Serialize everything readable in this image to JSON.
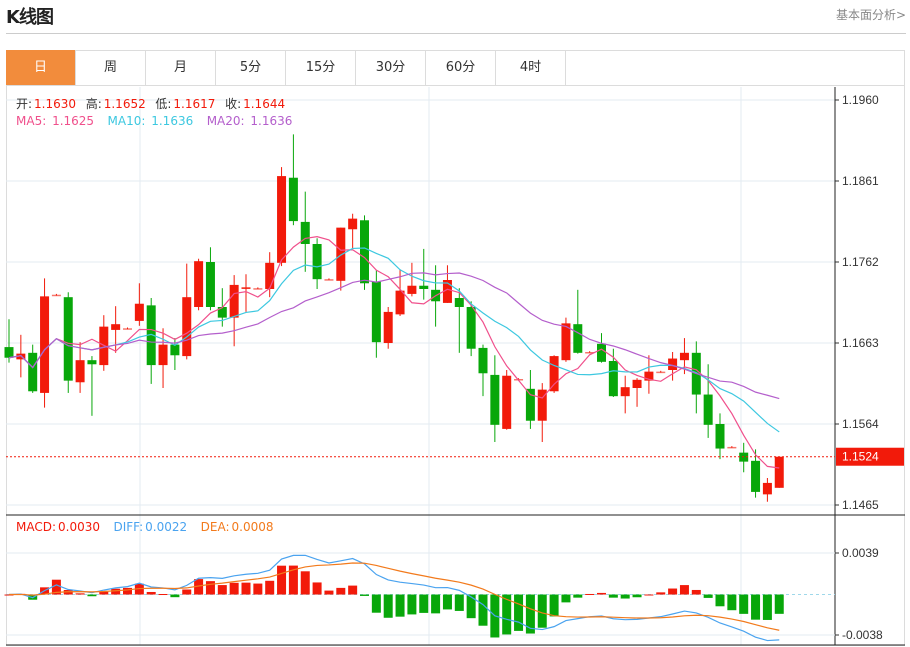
{
  "header": {
    "title": "K线图",
    "more_link": "基本面分析>"
  },
  "tabs": [
    {
      "label": "日",
      "active": true
    },
    {
      "label": "周"
    },
    {
      "label": "月"
    },
    {
      "label": "5分"
    },
    {
      "label": "15分"
    },
    {
      "label": "30分"
    },
    {
      "label": "60分"
    },
    {
      "label": "4时"
    }
  ],
  "ohlc_info": {
    "open_label": "开:",
    "open": "1.1630",
    "high_label": "高:",
    "high": "1.1652",
    "low_label": "低:",
    "low": "1.1617",
    "close_label": "收:",
    "close": "1.1644"
  },
  "ma_info": {
    "ma5_label": "MA5:",
    "ma5": "1.1625",
    "ma10_label": "MA10:",
    "ma10": "1.1636",
    "ma20_label": "MA20:",
    "ma20": "1.1636"
  },
  "macd_info": {
    "macd_label": "MACD:",
    "macd": "0.0030",
    "diff_label": "DIFF:",
    "diff": "0.0022",
    "dea_label": "DEA:",
    "dea": "0.0008"
  },
  "colors": {
    "up": "#f21a0a",
    "down": "#08a70a",
    "ma5": "#f0508c",
    "ma10": "#3dc8e0",
    "ma20": "#b45fcc",
    "diff": "#4aa3ef",
    "dea": "#f27a1c",
    "active_tab": "#f28c3c",
    "last_price": "#f21a0a"
  },
  "chart_data": [
    {
      "type": "candlestick",
      "y_ticks": [
        "1.1960",
        "1.1861",
        "1.1762",
        "1.1663",
        "1.1564",
        "1.1465"
      ],
      "ylim": [
        1.1465,
        1.196
      ],
      "last_price": "1.1524",
      "grid": true,
      "ohlc": [
        [
          1.1658,
          1.1692,
          1.1639,
          1.1645
        ],
        [
          1.1643,
          1.1673,
          1.1621,
          1.165
        ],
        [
          1.1651,
          1.1661,
          1.1602,
          1.1604
        ],
        [
          1.1602,
          1.1742,
          1.1584,
          1.172
        ],
        [
          1.1722,
          1.1723,
          1.1721,
          1.1722
        ],
        [
          1.1719,
          1.1725,
          1.1602,
          1.1617
        ],
        [
          1.1615,
          1.1664,
          1.1602,
          1.1642
        ],
        [
          1.1642,
          1.1647,
          1.1574,
          1.1637
        ],
        [
          1.1636,
          1.1697,
          1.1629,
          1.1683
        ],
        [
          1.1679,
          1.1708,
          1.1651,
          1.1686
        ],
        [
          1.1681,
          1.1682,
          1.168,
          1.1681
        ],
        [
          1.169,
          1.1736,
          1.1684,
          1.1711
        ],
        [
          1.1709,
          1.1718,
          1.1613,
          1.1636
        ],
        [
          1.1636,
          1.1681,
          1.1608,
          1.1661
        ],
        [
          1.1661,
          1.1669,
          1.163,
          1.1648
        ],
        [
          1.1647,
          1.176,
          1.1643,
          1.1719
        ],
        [
          1.1707,
          1.1766,
          1.1703,
          1.1763
        ],
        [
          1.1762,
          1.178,
          1.1703,
          1.1707
        ],
        [
          1.1707,
          1.173,
          1.1683,
          1.1694
        ],
        [
          1.1694,
          1.1746,
          1.1659,
          1.1734
        ],
        [
          1.173,
          1.1747,
          1.1701,
          1.1731
        ],
        [
          1.173,
          1.1731,
          1.1729,
          1.173
        ],
        [
          1.1729,
          1.1774,
          1.1719,
          1.1761
        ],
        [
          1.1761,
          1.1878,
          1.1757,
          1.1867
        ],
        [
          1.1865,
          1.1918,
          1.1807,
          1.1812
        ],
        [
          1.1811,
          1.1848,
          1.175,
          1.1784
        ],
        [
          1.1784,
          1.1791,
          1.1729,
          1.1741
        ],
        [
          1.1741,
          1.1742,
          1.174,
          1.1741
        ],
        [
          1.1739,
          1.1804,
          1.1727,
          1.1804
        ],
        [
          1.1802,
          1.1821,
          1.1779,
          1.1815
        ],
        [
          1.1813,
          1.1819,
          1.1728,
          1.1736
        ],
        [
          1.1738,
          1.1752,
          1.1645,
          1.1664
        ],
        [
          1.1663,
          1.1707,
          1.1656,
          1.1701
        ],
        [
          1.1698,
          1.1753,
          1.1696,
          1.1727
        ],
        [
          1.1723,
          1.1761,
          1.172,
          1.1733
        ],
        [
          1.1733,
          1.1778,
          1.1716,
          1.1729
        ],
        [
          1.1728,
          1.1758,
          1.1683,
          1.1714
        ],
        [
          1.1712,
          1.1758,
          1.1712,
          1.174
        ],
        [
          1.1718,
          1.173,
          1.1651,
          1.1707
        ],
        [
          1.1707,
          1.1714,
          1.1647,
          1.1656
        ],
        [
          1.1657,
          1.1661,
          1.1598,
          1.1626
        ],
        [
          1.1624,
          1.1648,
          1.1542,
          1.1563
        ],
        [
          1.1558,
          1.163,
          1.1557,
          1.1623
        ],
        [
          1.1619,
          1.162,
          1.1618,
          1.1619
        ],
        [
          1.1607,
          1.163,
          1.1558,
          1.1568
        ],
        [
          1.1568,
          1.1614,
          1.1542,
          1.1606
        ],
        [
          1.1604,
          1.1648,
          1.1602,
          1.1647
        ],
        [
          1.1642,
          1.1694,
          1.164,
          1.1687
        ],
        [
          1.1686,
          1.1728,
          1.165,
          1.1651
        ],
        [
          1.1652,
          1.1653,
          1.1651,
          1.1652
        ],
        [
          1.1662,
          1.1675,
          1.1639,
          1.164
        ],
        [
          1.1641,
          1.1656,
          1.1597,
          1.1598
        ],
        [
          1.1598,
          1.1623,
          1.1577,
          1.1609
        ],
        [
          1.1608,
          1.162,
          1.1585,
          1.1618
        ],
        [
          1.1617,
          1.1648,
          1.1601,
          1.1628
        ],
        [
          1.1628,
          1.1629,
          1.1627,
          1.1628
        ],
        [
          1.163,
          1.1652,
          1.1617,
          1.1644
        ],
        [
          1.1642,
          1.1669,
          1.1625,
          1.1651
        ],
        [
          1.1651,
          1.1665,
          1.1577,
          1.16
        ],
        [
          1.16,
          1.1637,
          1.1547,
          1.1563
        ],
        [
          1.1564,
          1.1577,
          1.1521,
          1.1534
        ],
        [
          1.1536,
          1.1537,
          1.1535,
          1.1536
        ],
        [
          1.1529,
          1.1541,
          1.1505,
          1.1518
        ],
        [
          1.1519,
          1.1533,
          1.1474,
          1.1481
        ],
        [
          1.1478,
          1.1498,
          1.1469,
          1.1492
        ],
        [
          1.1486,
          1.1524,
          1.1486,
          1.1524
        ]
      ],
      "moving_averages": [
        "MA5",
        "MA10",
        "MA20"
      ]
    },
    {
      "type": "macd",
      "y_ticks": [
        "0.0039",
        "-0.0038"
      ],
      "ylim": [
        -0.0038,
        0.0039
      ],
      "series": [
        "MACD",
        "DIFF",
        "DEA"
      ]
    }
  ]
}
